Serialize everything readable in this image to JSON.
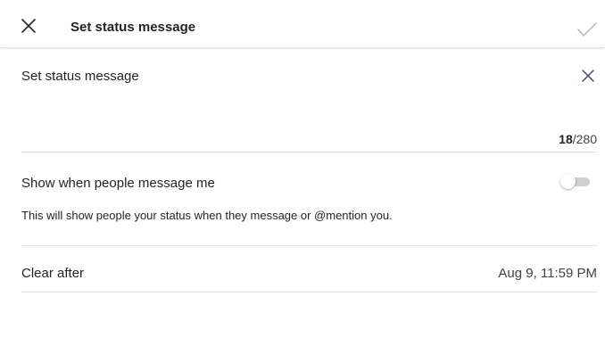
{
  "header": {
    "title": "Set status message",
    "close_icon": "close-icon",
    "confirm_icon": "checkmark-icon"
  },
  "message": {
    "text": "Set status message",
    "clear_icon": "clear-icon",
    "char_count": "18",
    "char_limit": "/280"
  },
  "show_when_messaged": {
    "label": "Show when people message me",
    "enabled": false,
    "hint": "This will show people your status when they message or @mention you."
  },
  "clear_after": {
    "label": "Clear after",
    "value": "Aug 9, 11:59 PM"
  },
  "colors": {
    "accent": "#464775",
    "text": "#242424",
    "divider": "#e1e1e1",
    "toggle_off": "#cfcfcf"
  }
}
